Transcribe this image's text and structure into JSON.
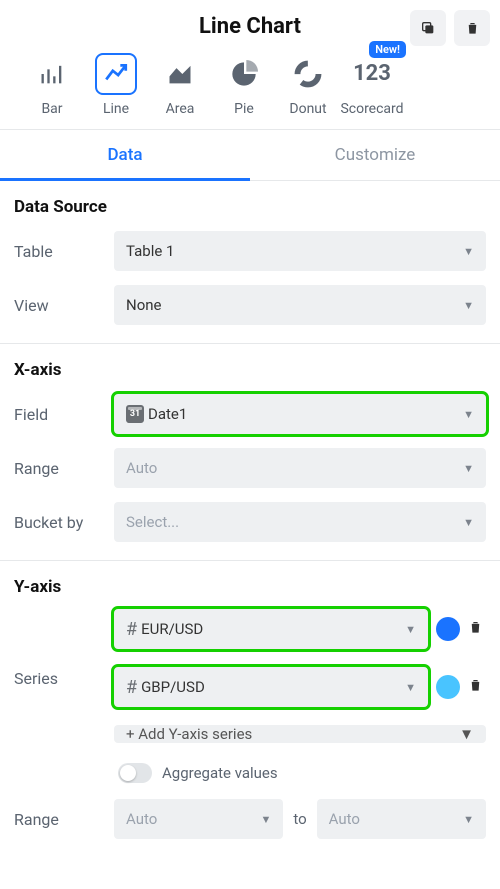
{
  "header": {
    "title": "Line Chart"
  },
  "chartTypes": [
    {
      "id": "bar",
      "label": "Bar"
    },
    {
      "id": "line",
      "label": "Line"
    },
    {
      "id": "area",
      "label": "Area"
    },
    {
      "id": "pie",
      "label": "Pie"
    },
    {
      "id": "donut",
      "label": "Donut"
    },
    {
      "id": "scorecard",
      "label": "Scorecard",
      "badge": "New!",
      "glyph": "123"
    }
  ],
  "tabs": {
    "data": "Data",
    "customize": "Customize"
  },
  "dataSource": {
    "title": "Data Source",
    "tableLabel": "Table",
    "tableValue": "Table 1",
    "viewLabel": "View",
    "viewValue": "None"
  },
  "xaxis": {
    "title": "X-axis",
    "fieldLabel": "Field",
    "fieldValue": "Date1",
    "fieldIconText": "31",
    "rangeLabel": "Range",
    "rangeValue": "Auto",
    "bucketLabel": "Bucket by",
    "bucketValue": "Select..."
  },
  "yaxis": {
    "title": "Y-axis",
    "seriesLabel": "Series",
    "series": [
      {
        "name": "EUR/USD",
        "color": "#1a73ff"
      },
      {
        "name": "GBP/USD",
        "color": "#49c4ff"
      }
    ],
    "addLabel": "+ Add Y-axis series",
    "aggregateLabel": "Aggregate values",
    "rangeLabel": "Range",
    "rangeFrom": "Auto",
    "rangeToLabel": "to",
    "rangeTo": "Auto"
  }
}
